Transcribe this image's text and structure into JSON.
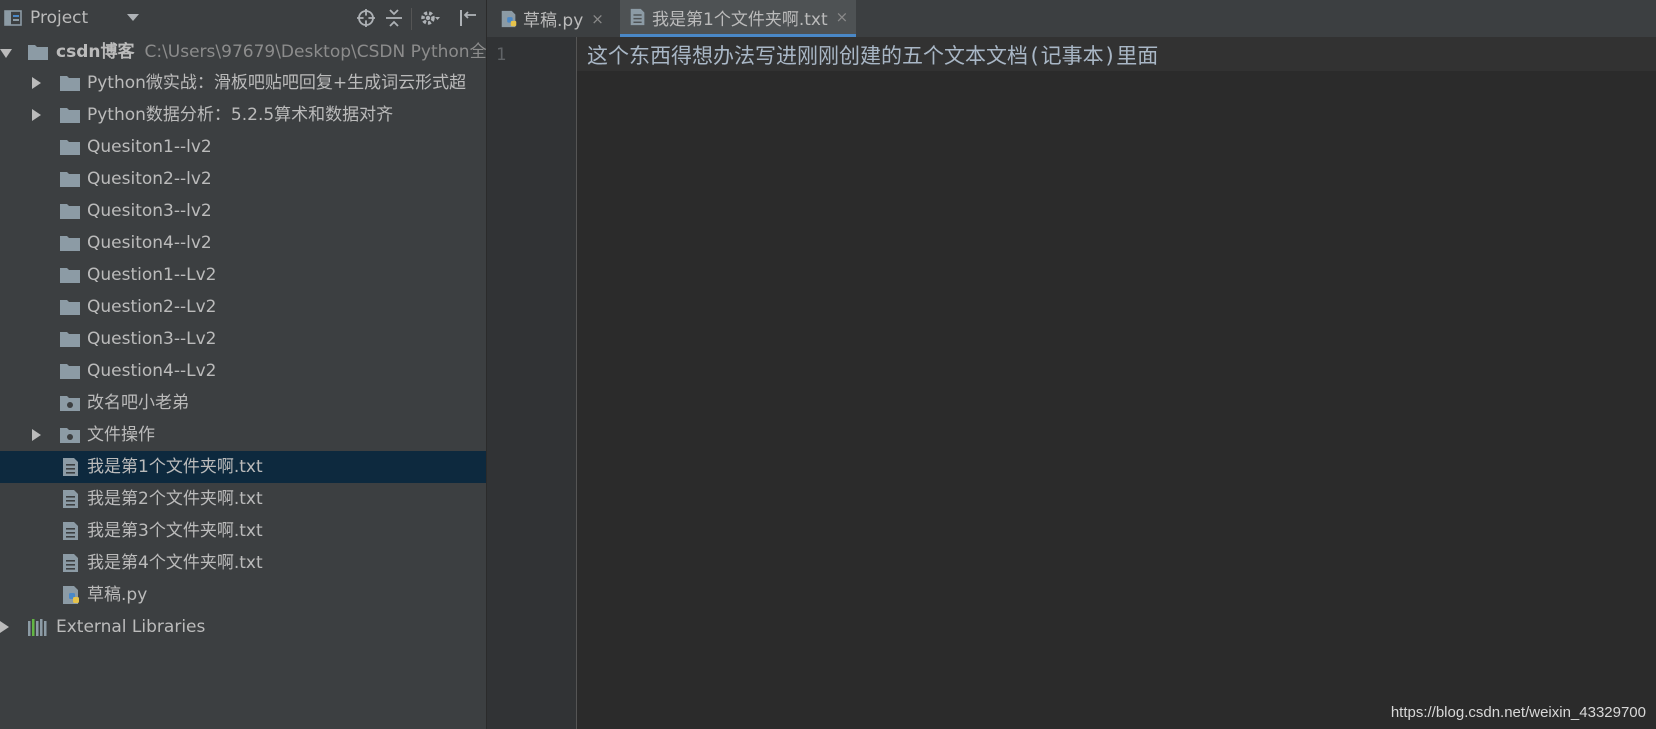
{
  "project_panel": {
    "title": "Project",
    "toolbar": {
      "locate_icon": "crosshair-icon",
      "collapse_icon": "collapse-all-icon",
      "settings_icon": "gear-icon",
      "hide_icon": "hide-panel-icon"
    },
    "root": {
      "name": "csdn博客",
      "path": "C:\\Users\\97679\\Desktop\\CSDN Python全"
    },
    "items": [
      {
        "label": "Python微实战：滑板吧贴吧回复+生成词云形式超"
      },
      {
        "label": "Python数据分析：5.2.5算术和数据对齐"
      },
      {
        "label": "Quesiton1--lv2"
      },
      {
        "label": "Quesiton2--lv2"
      },
      {
        "label": "Quesiton3--lv2"
      },
      {
        "label": "Quesiton4--lv2"
      },
      {
        "label": "Question1--Lv2"
      },
      {
        "label": "Question2--Lv2"
      },
      {
        "label": "Question3--Lv2"
      },
      {
        "label": "Question4--Lv2"
      },
      {
        "label": "改名吧小老弟"
      },
      {
        "label": "文件操作"
      },
      {
        "label": "我是第1个文件夹啊.txt"
      },
      {
        "label": "我是第2个文件夹啊.txt"
      },
      {
        "label": "我是第3个文件夹啊.txt"
      },
      {
        "label": "我是第4个文件夹啊.txt"
      },
      {
        "label": "草稿.py"
      }
    ],
    "external_libraries": "External Libraries"
  },
  "editor": {
    "tabs": [
      {
        "label": "草稿.py",
        "icon": "python-file-icon",
        "close": "×",
        "active": false
      },
      {
        "label": "我是第1个文件夹啊.txt",
        "icon": "text-file-icon",
        "close": "×",
        "active": true
      }
    ],
    "line_number": "1",
    "content": "这个东西得想办法写进刚刚创建的五个文本文档(记事本)里面"
  },
  "watermark": "https://blog.csdn.net/weixin_43329700",
  "colors": {
    "panel_bg": "#3c3f41",
    "editor_bg": "#2b2b2b",
    "selection_bg": "#0d293e",
    "folder": "#8c9ba5",
    "active_tab_underline": "#4a88c7"
  }
}
